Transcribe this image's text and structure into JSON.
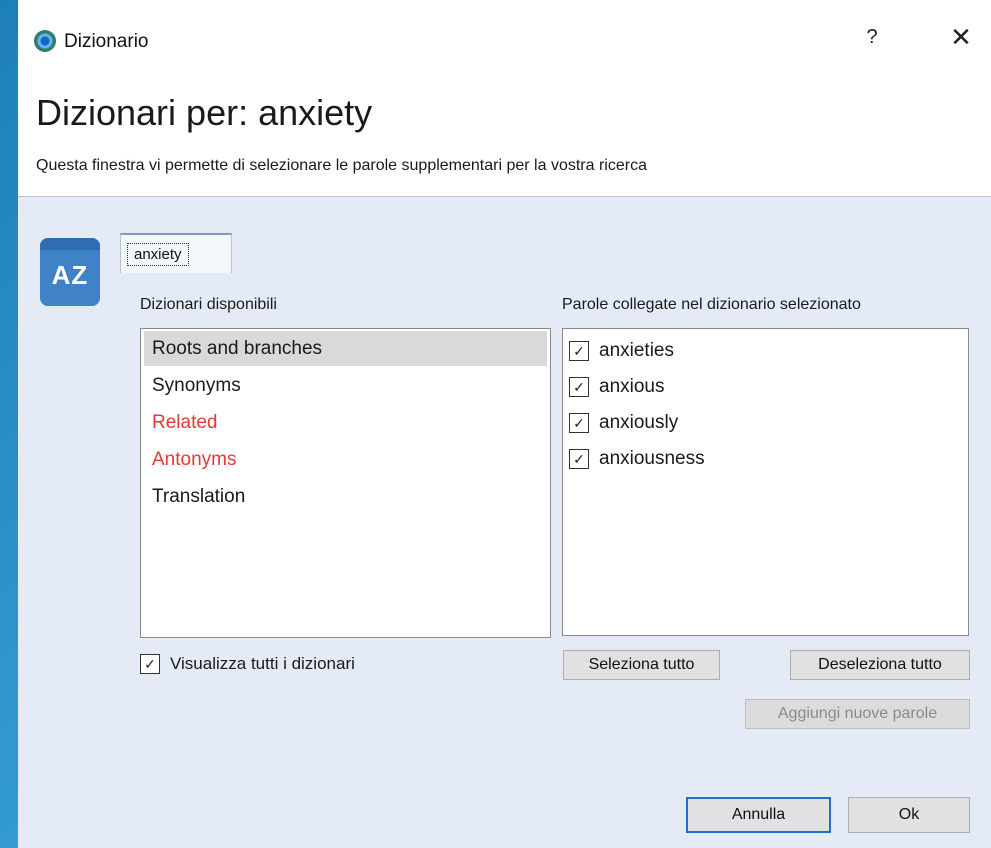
{
  "window": {
    "title": "Dizionario",
    "help_label": "?",
    "close_label": "✕"
  },
  "header": {
    "heading": "Dizionari per: anxiety",
    "subtitle": "Questa finestra vi permette di selezionare le parole supplementari per la vostra ricerca"
  },
  "icon_letters": "AZ",
  "tab": {
    "label": "anxiety"
  },
  "dictionaries": {
    "label": "Dizionari disponibili",
    "items": [
      {
        "label": "Roots and branches",
        "selected": true,
        "color": "#1a1a1a"
      },
      {
        "label": "Synonyms",
        "selected": false,
        "color": "#1a1a1a"
      },
      {
        "label": "Related",
        "selected": false,
        "color": "#e53935"
      },
      {
        "label": "Antonyms",
        "selected": false,
        "color": "#e53935"
      },
      {
        "label": "Translation",
        "selected": false,
        "color": "#1a1a1a"
      }
    ],
    "show_all_label": "Visualizza tutti i dizionari",
    "show_all_checked": true
  },
  "words": {
    "label": "Parole collegate nel dizionario selezionato",
    "items": [
      {
        "label": "anxieties",
        "checked": true
      },
      {
        "label": "anxious",
        "checked": true
      },
      {
        "label": "anxiously",
        "checked": true
      },
      {
        "label": "anxiousness",
        "checked": true
      }
    ]
  },
  "buttons": {
    "select_all": "Seleziona tutto",
    "deselect_all": "Deseleziona tutto",
    "add_words": "Aggiungi nuove parole",
    "cancel": "Annulla",
    "ok": "Ok"
  },
  "colors": {
    "accent": "#1e6fcf",
    "related_red": "#e53935",
    "dialog_bg": "#e5ebf6"
  }
}
